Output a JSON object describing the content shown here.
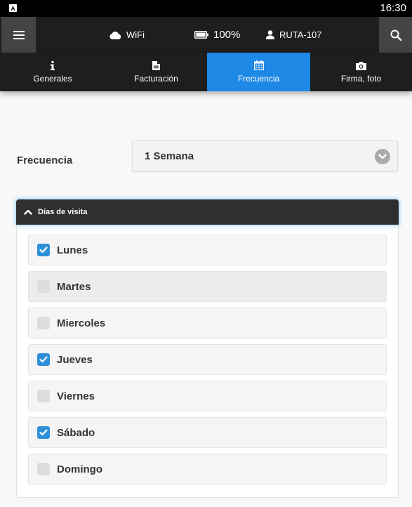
{
  "statusbar": {
    "time": "16:30",
    "app_icon": "app-icon"
  },
  "topbar": {
    "menu_icon": "menu-icon",
    "wifi_label": "WiFi",
    "battery_label": "100%",
    "user_label": "RUTA-107",
    "search_icon": "search-icon"
  },
  "tabs": [
    {
      "label": "Generales",
      "icon": "info-icon",
      "active": false
    },
    {
      "label": "Facturación",
      "icon": "document-icon",
      "active": false
    },
    {
      "label": "Frecuencia",
      "icon": "calendar-icon",
      "active": true
    },
    {
      "label": "Firma, foto",
      "icon": "camera-icon",
      "active": false
    }
  ],
  "frecuencia": {
    "label": "Frecuencia",
    "selected": "1 Semana"
  },
  "dias": {
    "title": "Días de visita",
    "items": [
      {
        "label": "Lunes",
        "checked": true
      },
      {
        "label": "Martes",
        "checked": false
      },
      {
        "label": "Miercoles",
        "checked": false
      },
      {
        "label": "Jueves",
        "checked": true
      },
      {
        "label": "Viernes",
        "checked": false
      },
      {
        "label": "Sábado",
        "checked": true
      },
      {
        "label": "Domingo",
        "checked": false
      }
    ]
  },
  "colors": {
    "accent": "#1e88e5",
    "checkbox": "#2d8fd8",
    "bar": "#1e1e1e"
  }
}
